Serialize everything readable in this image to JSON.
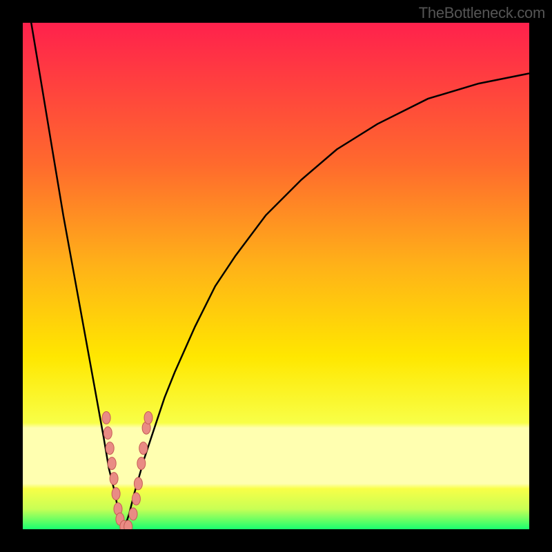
{
  "watermark": "TheBottleneck.com",
  "colors": {
    "gradient_top": "#ff214c",
    "gradient_mid1": "#ff6a2d",
    "gradient_mid2": "#ffb218",
    "gradient_mid3": "#ffe700",
    "gradient_low": "#f8ff47",
    "gradient_band": "#ffffb0",
    "gradient_bottom": "#19ff6f",
    "curve": "#000000",
    "marker": "#e98b84",
    "marker_stroke": "#c65b55"
  },
  "chart_data": {
    "type": "line",
    "title": "",
    "xlabel": "",
    "ylabel": "",
    "xlim": [
      0,
      100
    ],
    "ylim": [
      0,
      100
    ],
    "series": [
      {
        "name": "left-branch",
        "x": [
          0,
          2,
          4,
          6,
          8,
          10,
          12,
          14,
          16,
          17,
          18,
          19,
          20
        ],
        "y": [
          110,
          98,
          86,
          74,
          62,
          51,
          40,
          29,
          18,
          12,
          8,
          3,
          0
        ]
      },
      {
        "name": "right-branch",
        "x": [
          20,
          21,
          22,
          24,
          26,
          28,
          30,
          34,
          38,
          42,
          48,
          55,
          62,
          70,
          80,
          90,
          100
        ],
        "y": [
          0,
          3,
          7,
          14,
          20,
          26,
          31,
          40,
          48,
          54,
          62,
          69,
          75,
          80,
          85,
          88,
          90
        ]
      }
    ],
    "markers": {
      "name": "highlight-points",
      "points": [
        {
          "x": 16.5,
          "y": 22
        },
        {
          "x": 16.8,
          "y": 19
        },
        {
          "x": 17.2,
          "y": 16
        },
        {
          "x": 17.6,
          "y": 13
        },
        {
          "x": 18.0,
          "y": 10
        },
        {
          "x": 18.4,
          "y": 7
        },
        {
          "x": 18.8,
          "y": 4
        },
        {
          "x": 19.2,
          "y": 2
        },
        {
          "x": 20.0,
          "y": 0.5
        },
        {
          "x": 20.8,
          "y": 0.5
        },
        {
          "x": 21.8,
          "y": 3
        },
        {
          "x": 22.4,
          "y": 6
        },
        {
          "x": 22.8,
          "y": 9
        },
        {
          "x": 23.4,
          "y": 13
        },
        {
          "x": 23.8,
          "y": 16
        },
        {
          "x": 24.4,
          "y": 20
        },
        {
          "x": 24.8,
          "y": 22
        }
      ]
    }
  }
}
